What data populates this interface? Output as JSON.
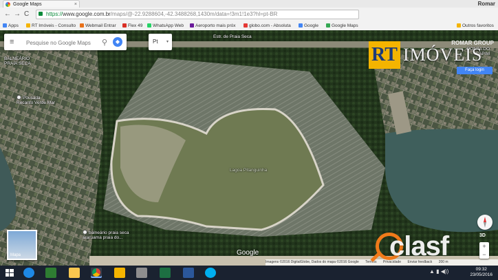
{
  "browser": {
    "tab_title": "Google Maps",
    "tab_close": "×",
    "window_user": "Romar",
    "back": "←",
    "forward": "→",
    "reload": "C",
    "url_https": "https://",
    "url_host": "www.google.com.br",
    "url_path": "/maps/@-22.9288604,-42.3488268,1430m/data=!3m1!1e3?hl=pt-BR",
    "bookmarks": [
      {
        "label": "Apps",
        "color": "#4285f4"
      },
      {
        "label": "RT Imóveis - Consulto",
        "color": "#f4b400"
      },
      {
        "label": "Webmail Entrar",
        "color": "#e8711a"
      },
      {
        "label": "Flex 49",
        "color": "#d93025"
      },
      {
        "label": "WhatsApp Web",
        "color": "#25d366"
      },
      {
        "label": "Aeroporto mais próx",
        "color": "#6a1b9a"
      },
      {
        "label": "globo.com - Absoluta",
        "color": "#e53935"
      },
      {
        "label": "Google",
        "color": "#4285f4"
      },
      {
        "label": "Google Maps",
        "color": "#34a853"
      },
      {
        "label": "Outros favoritos",
        "color": "#f4b400"
      }
    ]
  },
  "maps": {
    "search_placeholder": "Pesquise no Google Maps",
    "menu_icon": "≡",
    "search_icon": "⚲",
    "directions_icon": "◆",
    "language": "Pt",
    "language_caret": "▾",
    "labels": {
      "top_road": "Estr. de Praia Seca",
      "bairro": "BALNEÁRIO PRAIA SECA",
      "pousada": "Pousada Recanto Verde Mar",
      "lagoa": "Lagoa Pitanguinha",
      "praia": "balneário praia seca araruama praia do...",
      "right_area": "PONTA DO CAPIM"
    },
    "minimap_label": "Mapa",
    "zoom_in": "+",
    "zoom_out": "−",
    "three_d": "3D",
    "google_logo": "Google",
    "footer": [
      "Imagens ©2016 DigitalGlobe, Dados do mapa ©2016 Google",
      "Termos",
      "Privacidade",
      "Enviar feedback",
      "200 m"
    ]
  },
  "overlay": {
    "rt_badge": "RT",
    "rt_name": "IMÓVEIS",
    "romar_group": "ROMAR GROUP",
    "save_button": "Faça login",
    "watermark": "clasf"
  },
  "taskbar": {
    "time": "09:32",
    "date": "23/05/2016",
    "apps": [
      "ie-icon",
      "store-icon",
      "folder-icon",
      "chrome-icon",
      "notes-icon",
      "paint-icon",
      "excel-icon",
      "word-icon",
      "skype-icon"
    ]
  }
}
